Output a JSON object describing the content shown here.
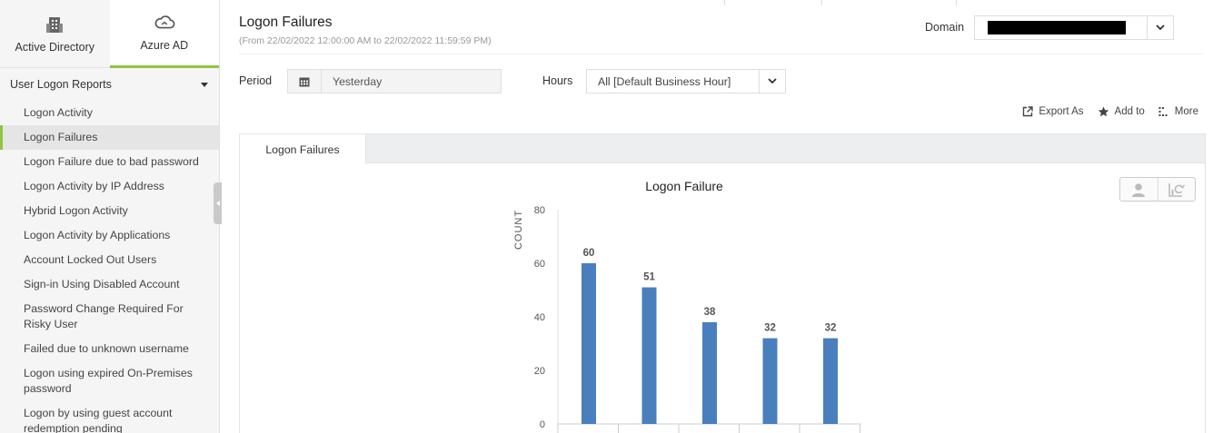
{
  "sidebar": {
    "tabs": [
      {
        "label": "Active Directory",
        "icon": "building-icon"
      },
      {
        "label": "Azure AD",
        "icon": "cloud-icon"
      }
    ],
    "section": "User Logon Reports",
    "items": [
      {
        "label": "Logon Activity"
      },
      {
        "label": "Logon Failures"
      },
      {
        "label": "Logon Failure due to bad password"
      },
      {
        "label": "Logon Activity by IP Address"
      },
      {
        "label": "Hybrid Logon Activity"
      },
      {
        "label": "Logon Activity by Applications"
      },
      {
        "label": "Account Locked Out Users"
      },
      {
        "label": "Sign-in Using Disabled Account"
      },
      {
        "label": "Password Change Required For Risky User"
      },
      {
        "label": "Failed due to unknown username"
      },
      {
        "label": "Logon using expired On-Premises password"
      },
      {
        "label": "Logon by using guest account redemption pending"
      }
    ]
  },
  "header": {
    "title": "Logon Failures",
    "range": "(From 22/02/2022 12:00:00 AM to 22/02/2022 11:59:59 PM)",
    "domain_label": "Domain"
  },
  "filters": {
    "period_label": "Period",
    "period_value": "Yesterday",
    "hours_label": "Hours",
    "hours_value": "All [Default Business Hour]"
  },
  "actions": {
    "export": "Export As",
    "add": "Add to",
    "more": "More"
  },
  "report_tab": "Logon Failures",
  "colors": {
    "accent": "#8dc63f",
    "bar": "#4a7fbd"
  },
  "chart_data": {
    "type": "bar",
    "title": "Logon Failure",
    "ylabel": "COUNT",
    "xlabel": "",
    "ylim": [
      0,
      80
    ],
    "yticks": [
      0,
      20,
      40,
      60,
      80
    ],
    "values": [
      60,
      51,
      38,
      32,
      32
    ],
    "grid": false
  }
}
